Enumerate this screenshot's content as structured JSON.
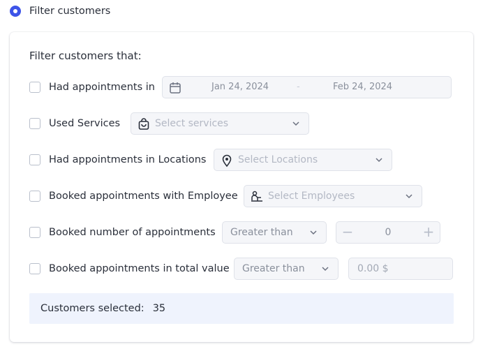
{
  "section": {
    "radio_label": "Filter customers"
  },
  "card": {
    "title": "Filter customers that:",
    "rows": [
      {
        "label": "Had appointments in",
        "date_from": "Jan 24, 2024",
        "date_sep": "-",
        "date_to": "Feb 24, 2024"
      },
      {
        "label": "Used Services",
        "placeholder": "Select services"
      },
      {
        "label": "Had appointments in Locations",
        "placeholder": "Select Locations"
      },
      {
        "label": "Booked appointments with Employee",
        "placeholder": "Select Employees"
      },
      {
        "label": "Booked number of appointments",
        "select_value": "Greater than",
        "number_value": "0",
        "minus": "−",
        "plus": "+"
      },
      {
        "label": "Booked appointments in total value",
        "select_value": "Greater than",
        "amount_placeholder": "0.00 $"
      }
    ],
    "summary": {
      "label": "Customers selected:",
      "count": "35"
    }
  },
  "colors": {
    "accent": "#3d54e8",
    "summary_bg": "#eff3fd"
  }
}
